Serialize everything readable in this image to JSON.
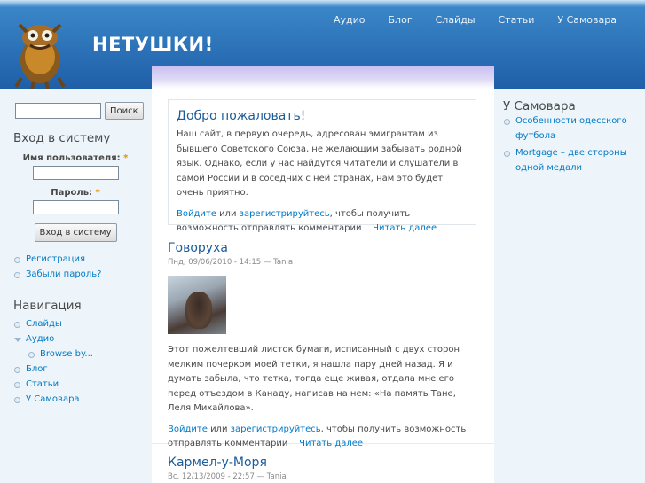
{
  "site": {
    "name": "НЕТУШКИ!"
  },
  "primary_links": [
    "Аудио",
    "Блог",
    "Слайды",
    "Статьи",
    "У Самовара"
  ],
  "search": {
    "button": "Поиск",
    "value": ""
  },
  "login": {
    "title": "Вход в систему",
    "username_label": "Имя пользователя:",
    "password_label": "Пароль:",
    "required_mark": "*",
    "submit": "Вход в систему",
    "links": [
      "Регистрация",
      "Забыли пароль?"
    ]
  },
  "navigation": {
    "title": "Навигация",
    "items": [
      "Слайды",
      "Аудио",
      "Browse by...",
      "Блог",
      "Статьи",
      "У Самовара"
    ]
  },
  "right_block": {
    "title": "У Самовара",
    "items": [
      "Особенности одесского футбола",
      "Mortgage – две стороны одной медали"
    ]
  },
  "welcome": {
    "title": "Добро пожаловать!",
    "body": "Наш сайт, в первую очередь, адресован эмигрантам из бывшего Советского Союза, не желающим забывать родной язык. Однако, если у нас найдутся читатели и слушатели в самой России и в соседних с ней странах, нам это будет очень приятно.",
    "login_link": "Войдите",
    "or": "или",
    "register_link": "зарегистрируйтесь",
    "suffix": ", чтобы получить возможность отправлять комментарии",
    "read_more": "Читать далее"
  },
  "posts": [
    {
      "title": "Говоруха",
      "submitted": "Пнд, 09/06/2010 - 14:15 — Tania",
      "body": "Этот пожелтевший листок бумаги, исписанный с двух сторон мелким почерком моей тетки, я нашла пару дней назад. Я и думать забыла, что тетка, тогда еще живая, отдала мне его перед отъездом в Канаду, написав на нем: «На память Тане, Леля Михайлова».",
      "login_link": "Войдите",
      "or": "или",
      "register_link": "зарегистрируйтесь",
      "suffix": ", чтобы получить возможность отправлять комментарии",
      "read_more": "Читать далее"
    },
    {
      "title": "Кармел-у-Моря",
      "submitted": "Вс, 12/13/2009 - 22:57 — Tania"
    }
  ]
}
